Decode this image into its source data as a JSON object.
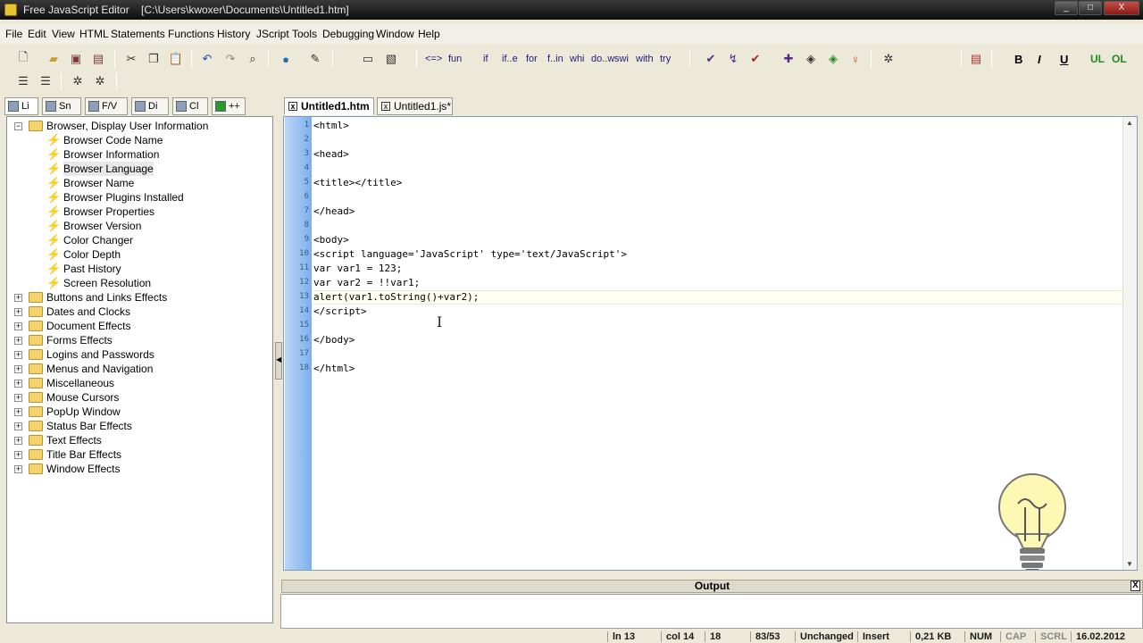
{
  "window": {
    "title": "Free JavaScript Editor",
    "path": "[C:\\Users\\kwoxer\\Documents\\Untitled1.htm]",
    "min": "_",
    "max": "□",
    "close": "X"
  },
  "menu": [
    "File",
    "Edit",
    "View",
    "HTML",
    "Statements",
    "Functions",
    "History",
    "JScript",
    "Tools",
    "Debugging",
    "Window",
    "Help"
  ],
  "toolbar": {
    "code_snippets": [
      "<=>",
      "fun",
      "if",
      "if..e",
      "for",
      "f..in",
      "whi",
      "do..w",
      "swi",
      "with",
      "try"
    ],
    "format": {
      "bold": "B",
      "italic": "I",
      "underline": "U",
      "ul": "UL",
      "ol": "OL"
    }
  },
  "left_tabs": [
    "Li",
    "Sn",
    "F/V",
    "Di",
    "Cl",
    "++"
  ],
  "tree": {
    "expanded": {
      "label": "Browser, Display User Information",
      "children": [
        "Browser Code Name",
        "Browser Information",
        "Browser Language",
        "Browser Name",
        "Browser Plugins Installed",
        "Browser Properties",
        "Browser Version",
        "Color Changer",
        "Color Depth",
        "Past History",
        "Screen Resolution"
      ]
    },
    "collapsed": [
      "Buttons and Links Effects",
      "Dates and Clocks",
      "Document Effects",
      "Forms Effects",
      "Logins and Passwords",
      "Menus and Navigation",
      "Miscellaneous",
      "Mouse Cursors",
      "PopUp Window",
      "Status Bar Effects",
      "Text Effects",
      "Title Bar Effects",
      "Window Effects"
    ]
  },
  "editor_tabs": [
    {
      "label": "Untitled1.htm",
      "active": true
    },
    {
      "label": "Untitled1.js*",
      "active": false
    }
  ],
  "code_lines": [
    "<html>",
    "",
    "<head>",
    "",
    "<title></title>",
    "",
    "</head>",
    "",
    "<body>",
    "<script language='JavaScript' type='text/JavaScript'>",
    "var var1 = 123;",
    "var var2 = !!var1;",
    "alert(var1.toString()+var2);",
    "</script>",
    "",
    "</body>",
    "",
    "</html>"
  ],
  "line_numbers": [
    "1",
    "2",
    "3",
    "4",
    "5",
    "6",
    "7",
    "8",
    "9",
    "10",
    "11",
    "12",
    "13",
    "14",
    "15",
    "16",
    "17",
    "18"
  ],
  "output": {
    "title": "Output",
    "close": "X"
  },
  "status": {
    "line": "ln 13",
    "col": "col 14",
    "lines": "18",
    "pos": "83/53",
    "modified": "Unchanged",
    "mode": "Insert",
    "size": "0,21 KB",
    "num": "NUM",
    "cap": "CAP",
    "scrl": "SCRL",
    "date": "16.02.2012"
  }
}
